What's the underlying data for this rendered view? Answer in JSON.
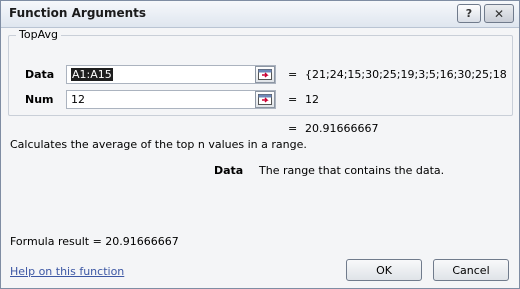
{
  "dialog": {
    "title": "Function Arguments",
    "help_button": "?",
    "close_button": "✕"
  },
  "function": {
    "name": "TopAvg",
    "args": [
      {
        "label": "Data",
        "input": "A1:A15",
        "value": "{21;24;15;30;25;19;3;5;16;30;25;18"
      },
      {
        "label": "Num",
        "input": "12",
        "value": "12"
      }
    ],
    "equals": "=",
    "result_value": "20.91666667",
    "description": "Calculates the average of the top n values in a range.",
    "arg_desc_label": "Data",
    "arg_desc_text": "The range that contains the data."
  },
  "footer": {
    "formula_result": "Formula result =  20.91666667",
    "help_link": "Help on this function",
    "ok_label": "OK",
    "cancel_label": "Cancel"
  },
  "icons": {
    "collapse": "collapse-dialog-icon",
    "help": "help-icon",
    "close": "close-icon"
  }
}
